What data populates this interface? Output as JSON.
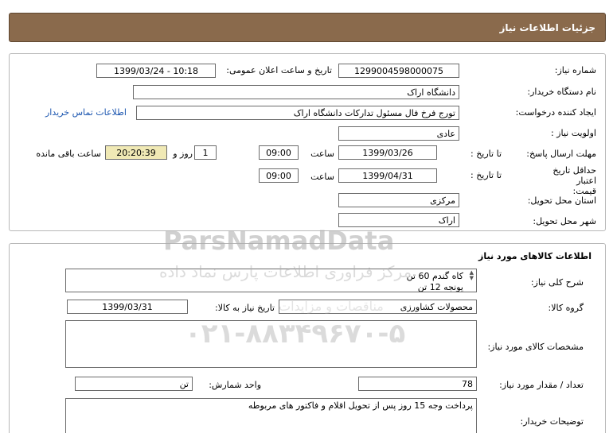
{
  "header": {
    "title": "جزئیات اطلاعات نیاز"
  },
  "need": {
    "need_number_label": "شماره نیاز:",
    "need_number": "1299004598000075",
    "announce_label": "تاریخ و ساعت اعلان عمومی:",
    "announce_value": "1399/03/24 - 10:18",
    "buyer_org_label": "نام دستگاه خریدار:",
    "buyer_org": "دانشگاه اراک",
    "requester_label": "ایجاد کننده درخواست:",
    "requester": "تورج فرخ فال مسئول تدارکات دانشگاه اراک",
    "contact_link": "اطلاعات تماس خریدار",
    "priority_label": "اولویت نیاز :",
    "priority": "عادی",
    "deadline_label": "مهلت ارسال پاسخ:",
    "to_date_label": "تا تاریخ :",
    "deadline_date": "1399/03/26",
    "time_label": "ساعت",
    "deadline_time": "09:00",
    "days_value": "1",
    "days_label": "روز و",
    "remaining_time": "20:20:39",
    "remaining_label": "ساعت باقی مانده",
    "validity_label": "حداقل تاریخ اعتبار قیمت:",
    "validity_date": "1399/04/31",
    "validity_time": "09:00",
    "province_label": "استان محل تحویل:",
    "province": "مرکزی",
    "city_label": "شهر محل تحویل:",
    "city": "اراک"
  },
  "goods": {
    "section_title": "اطلاعات کالاهای مورد نیاز",
    "summary_label": "شرح کلی نیاز:",
    "summary_lines": [
      "کاه گندم 60 تن",
      "یونجه 12 تن"
    ],
    "group_label": "گروه کالا:",
    "group": "محصولات کشاورزی",
    "need_date_label": "تاریخ نیاز به کالا:",
    "need_date": "1399/03/31",
    "specs_label": "مشخصات کالای مورد نیاز:",
    "specs": "",
    "qty_label": "تعداد / مقدار مورد نیاز:",
    "qty": "78",
    "unit_label": "واحد شمارش:",
    "unit": "تن",
    "buyer_notes_label": "توضیحات خریدار:",
    "buyer_notes": "پرداخت وجه 15 روز پس از تحویل اقلام و فاکتور های مربوطه"
  },
  "watermark": {
    "logo": "ParsNamadData",
    "slogan": "مرکز فراوری اطلاعات پارس نماد داده",
    "slogan2": "مناقصات و مزایدات",
    "phone": "۰۲۱-۸۸۳۴۹۶۷۰-۵"
  }
}
